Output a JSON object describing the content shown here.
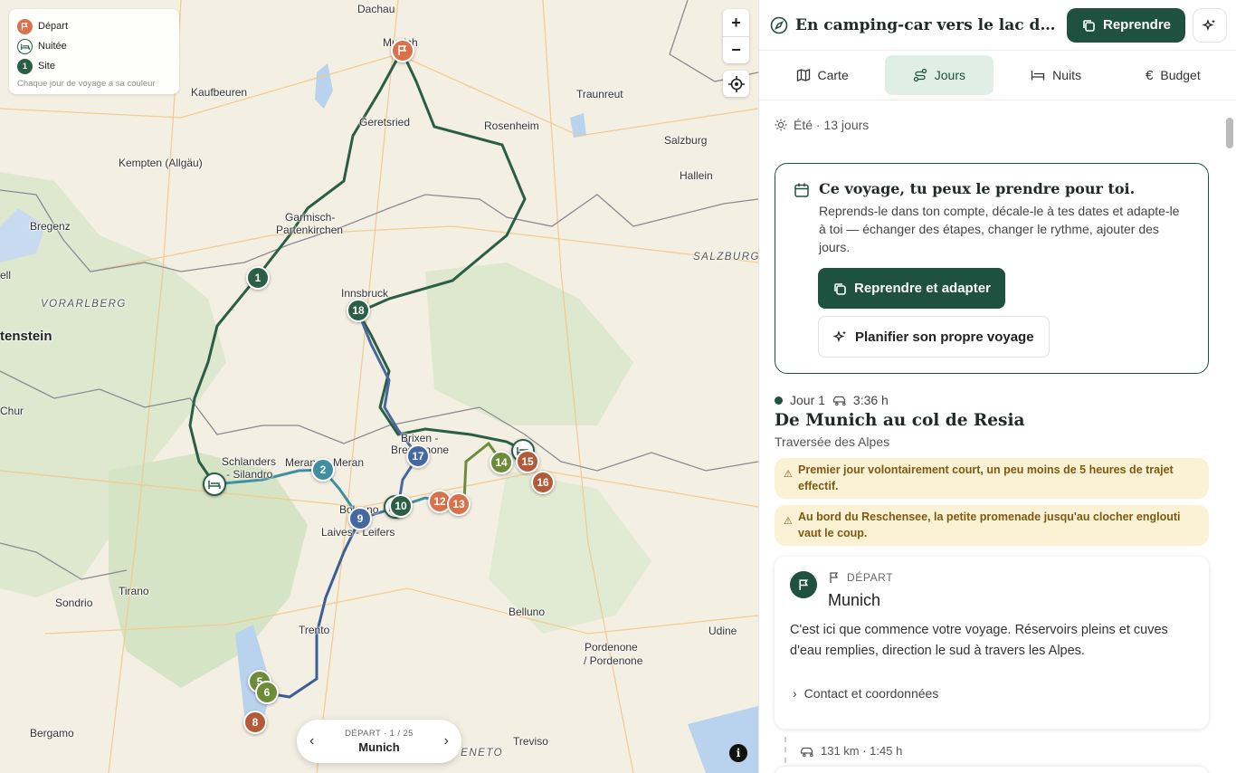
{
  "map": {
    "legend": {
      "depart": "Départ",
      "nuitee": "Nuitée",
      "site": "Site",
      "site_num": "1",
      "hint": "Chaque jour de voyage a sa couleur"
    },
    "zoom_in": "+",
    "zoom_out": "−",
    "info": "i",
    "nav": {
      "caption": "DÉPART · 1 / 25",
      "value": "Munich",
      "prev": "‹",
      "next": "›"
    },
    "labels": {
      "dachau": "Dachau",
      "munich": "Munich",
      "kaufbeuren": "Kaufbeuren",
      "geretsried": "Geretsried",
      "rosenheim": "Rosenheim",
      "traunreut": "Traunreut",
      "salzburg": "Salzburg",
      "hallein": "Hallein",
      "kempten": "Kempten (Allgäu)",
      "bregenz": "Bregenz",
      "garmisch1": "Garmisch-",
      "garmisch2": "Partenkirchen",
      "salzburg_region": "SALZBURG",
      "vorarlberg": "VORARLBERG",
      "liechtenstein": "tenstein",
      "innsbruck": "Innsbruck",
      "chur": "Chur",
      "schlanders1": "Schlanders",
      "schlanders2": "- Silandro",
      "meran1": "Meran",
      "meran2": "Meran",
      "brixen1": "Brixen -",
      "brixen2": "Bressanone",
      "bolzano": "Bolzano",
      "laives": "Laives - Leifers",
      "sondrio": "Sondrio",
      "tirano": "Tirano",
      "trento": "Trento",
      "belluno": "Belluno",
      "udine": "Udine",
      "pordenone1": "Pordenone",
      "pordenone2": "/ Pordenone",
      "bergamo": "Bergamo",
      "treviso": "Treviso",
      "veneto": "VENETO",
      "ell": "ell"
    },
    "markers": [
      "1",
      "2",
      "5",
      "6",
      "8",
      "9",
      "10",
      "12",
      "13",
      "14",
      "15",
      "16",
      "17",
      "18"
    ],
    "colors": {
      "green": "#2a5e45",
      "teal": "#3f8fa0",
      "blue": "#4668a0",
      "olive": "#6d8c3a",
      "orange": "#d9714a",
      "rust": "#b35a3a"
    }
  },
  "panel": {
    "title": "En camping-car vers le lac de Garde",
    "reprendre": "Reprendre",
    "tabs": {
      "carte": "Carte",
      "jours": "Jours",
      "nuits": "Nuits",
      "budget": "Budget"
    },
    "season": "Été · 13 jours",
    "cta": {
      "title": "Ce voyage, tu peux le prendre pour toi.",
      "text": "Reprends-le dans ton compte, décale-le à tes dates et adapte-le à toi — échanger des étapes, changer le rythme, ajouter des jours.",
      "primary": "Reprendre et adapter",
      "secondary": "Planifier son propre voyage"
    },
    "day": {
      "label": "Jour 1",
      "duration": "3:36 h",
      "title": "De Munich au col de Resia",
      "subtitle": "Traversée des Alpes",
      "warnings": [
        "Premier jour volontairement court, un peu moins de 5 heures de trajet effectif.",
        "Au bord du Reschensee, la petite promenade jusqu'au clocher englouti vaut le coup."
      ]
    },
    "card": {
      "kind": "DÉPART",
      "place": "Munich",
      "desc": "C'est ici que commence votre voyage. Réservoirs pleins et cuves d'eau remplies, direction le sud à travers les Alpes.",
      "more": "Contact et coordonnées"
    },
    "drive": "131 km · 1:45 h"
  }
}
